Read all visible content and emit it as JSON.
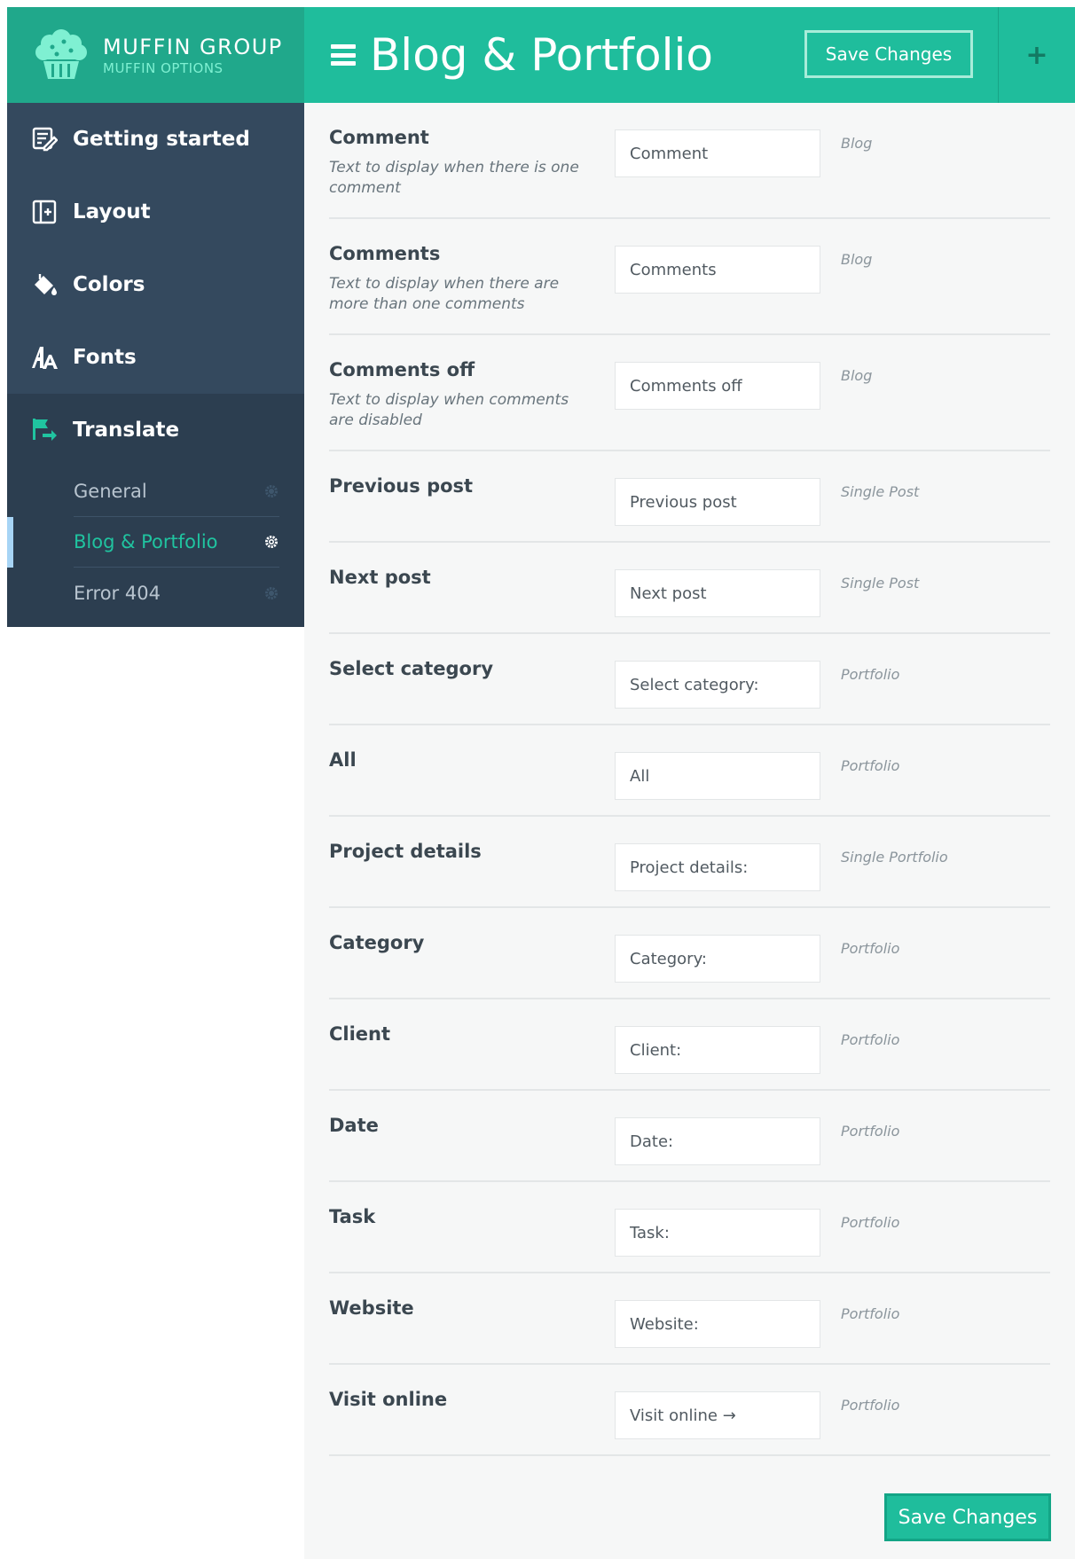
{
  "brand": {
    "name": "MUFFIN GROUP",
    "subtitle": "MUFFIN OPTIONS",
    "logo_icon": "muffin-icon"
  },
  "sidebar": {
    "items": [
      {
        "label": "Getting started",
        "icon": "document-edit-icon"
      },
      {
        "label": "Layout",
        "icon": "layout-plus-icon"
      },
      {
        "label": "Colors",
        "icon": "paint-bucket-icon"
      },
      {
        "label": "Fonts",
        "icon": "font-icon"
      },
      {
        "label": "Translate",
        "icon": "flag-icon"
      }
    ],
    "subitems": [
      {
        "label": "General",
        "icon": "gear-icon"
      },
      {
        "label": "Blog & Portfolio",
        "icon": "gear-icon",
        "active": true
      },
      {
        "label": "Error 404",
        "icon": "gear-icon"
      }
    ]
  },
  "header": {
    "title": "Blog & Portfolio",
    "save_label": "Save Changes",
    "plus_label": "+"
  },
  "fields": [
    {
      "title": "Comment",
      "desc": "Text to display when there is one comment",
      "value": "Comment",
      "section": "Blog"
    },
    {
      "title": "Comments",
      "desc": "Text to display when there are more than one comments",
      "value": "Comments",
      "section": "Blog"
    },
    {
      "title": "Comments off",
      "desc": "Text to display when comments are disabled",
      "value": "Comments off",
      "section": "Blog"
    },
    {
      "title": "Previous post",
      "desc": "",
      "value": "Previous post",
      "section": "Single Post"
    },
    {
      "title": "Next post",
      "desc": "",
      "value": "Next post",
      "section": "Single Post"
    },
    {
      "title": "Select category",
      "desc": "",
      "value": "Select category:",
      "section": "Portfolio"
    },
    {
      "title": "All",
      "desc": "",
      "value": "All",
      "section": "Portfolio"
    },
    {
      "title": "Project details",
      "desc": "",
      "value": "Project details:",
      "section": "Single Portfolio"
    },
    {
      "title": "Category",
      "desc": "",
      "value": "Category:",
      "section": "Portfolio"
    },
    {
      "title": "Client",
      "desc": "",
      "value": "Client:",
      "section": "Portfolio"
    },
    {
      "title": "Date",
      "desc": "",
      "value": "Date:",
      "section": "Portfolio"
    },
    {
      "title": "Task",
      "desc": "",
      "value": "Task:",
      "section": "Portfolio"
    },
    {
      "title": "Website",
      "desc": "",
      "value": "Website:",
      "section": "Portfolio"
    },
    {
      "title": "Visit online",
      "desc": "",
      "value": "Visit online →",
      "section": "Portfolio"
    }
  ],
  "footer": {
    "save_label": "Save Changes"
  },
  "colors": {
    "accent": "#1fbd9c",
    "brand_bg": "#20a88b",
    "sidebar_bg": "#34495e",
    "sidebar_sub_bg": "#2c3e50",
    "active_text": "#20c4a0"
  }
}
